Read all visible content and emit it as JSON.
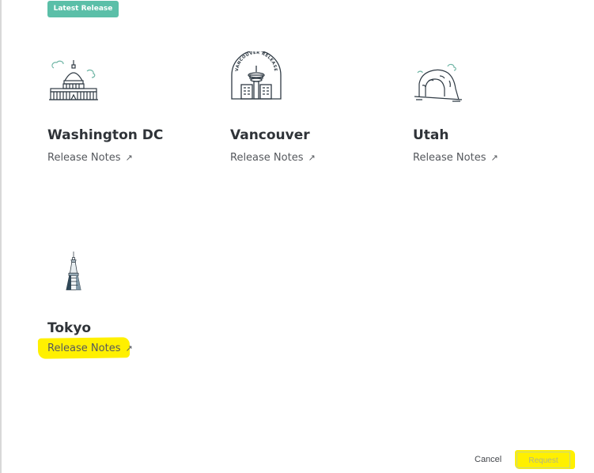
{
  "badge": {
    "label": "Latest Release"
  },
  "releases": [
    {
      "title": "Washington DC",
      "link_label": "Release Notes",
      "icon": "capitol-building-icon"
    },
    {
      "title": "Vancouver",
      "link_label": "Release Notes",
      "icon": "vancouver-tower-icon",
      "emblem_text": "VANCOUVER RELEASE"
    },
    {
      "title": "Utah",
      "link_label": "Release Notes",
      "icon": "utah-arch-icon"
    },
    {
      "title": "Tokyo",
      "link_label": "Release Notes",
      "icon": "tokyo-skytree-icon"
    }
  ],
  "link_arrow": "↗",
  "footer": {
    "cancel_label": "Cancel",
    "request_label": "Request"
  },
  "colors": {
    "badge": "#5bbfa8",
    "highlight": "#fff000",
    "text": "#2f3338",
    "link": "#55585d"
  }
}
